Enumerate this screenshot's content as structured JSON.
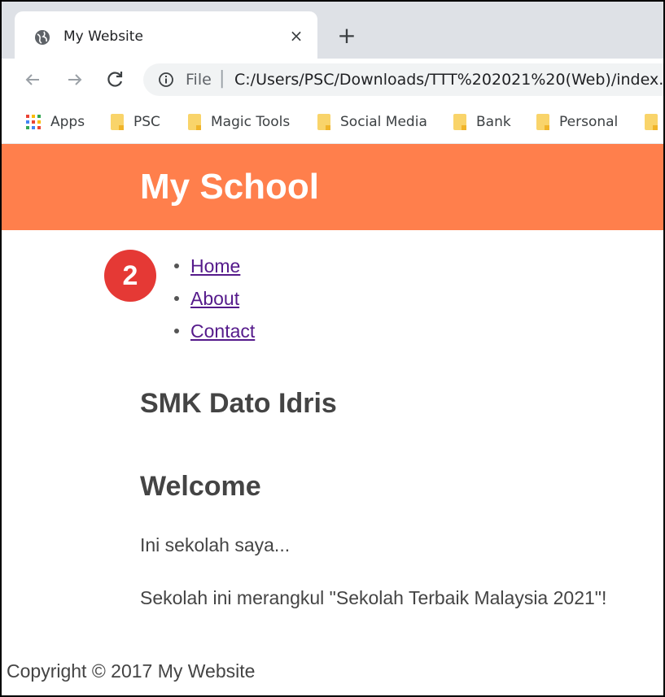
{
  "browser": {
    "tab_title": "My Website",
    "tab_close": "×",
    "new_tab": "+",
    "omnibox_scheme": "File",
    "omnibox_sep": "|",
    "url": "C:/Users/PSC/Downloads/TTT%202021%20(Web)/index."
  },
  "bookmarks": [
    {
      "label": "Apps",
      "icon": "apps-grid-icon"
    },
    {
      "label": "PSC",
      "icon": "folder-icon"
    },
    {
      "label": "Magic Tools",
      "icon": "folder-icon"
    },
    {
      "label": "Social Media",
      "icon": "folder-icon"
    },
    {
      "label": "Bank",
      "icon": "folder-icon"
    },
    {
      "label": "Personal",
      "icon": "folder-icon"
    }
  ],
  "page": {
    "site_title": "My School",
    "badge": "2",
    "nav": [
      "Home",
      "About",
      "Contact"
    ],
    "school_heading": "SMK Dato Idris",
    "welcome_heading": "Welcome",
    "paragraph1": "Ini sekolah saya...",
    "paragraph2": "Sekolah ini merangkul \"Sekolah Terbaik Malaysia 2021\"!",
    "footer": "Copyright © 2017 My Website"
  },
  "colors": {
    "header_bg": "#ff7f4c",
    "badge_bg": "#e53935",
    "link": "#551a8b",
    "tabstrip_bg": "#dee1e6"
  }
}
